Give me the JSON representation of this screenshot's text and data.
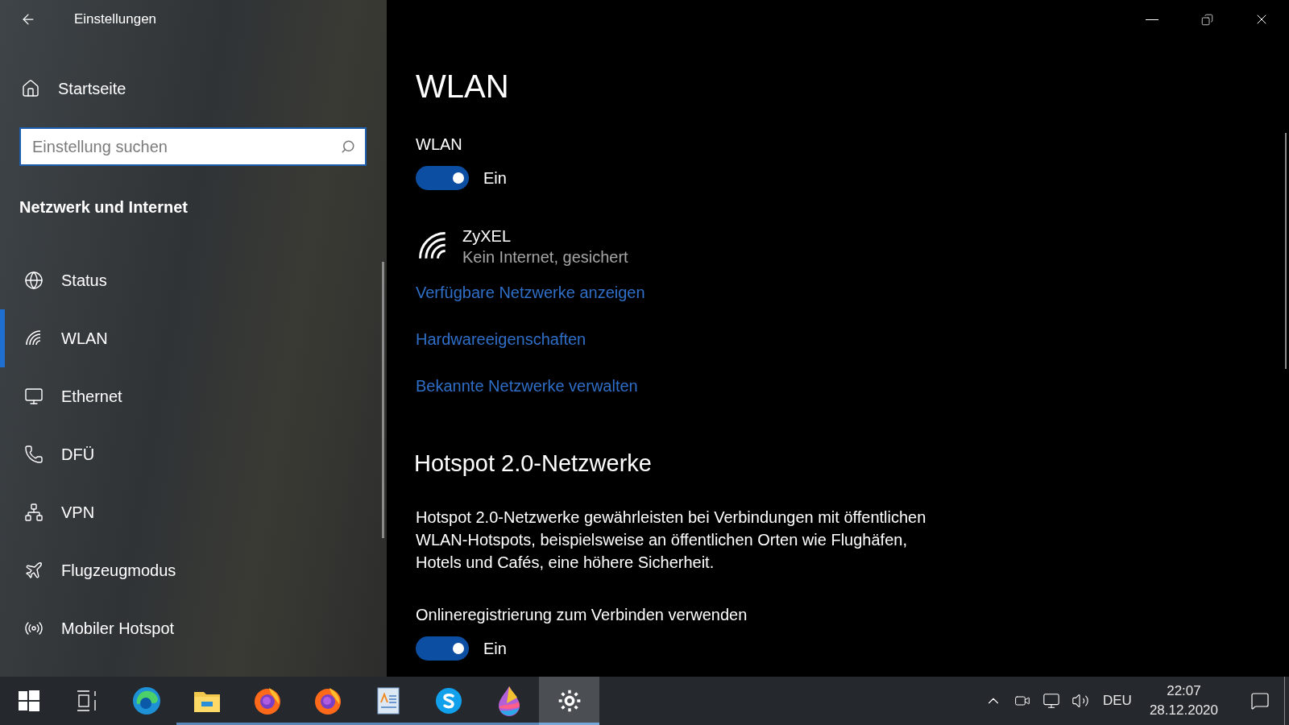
{
  "window": {
    "title": "Einstellungen"
  },
  "sidebar": {
    "home": "Startseite",
    "search": {
      "placeholder": "Einstellung suchen"
    },
    "section": "Netzwerk und Internet",
    "items": [
      {
        "label": "Status",
        "selected": false
      },
      {
        "label": "WLAN",
        "selected": true
      },
      {
        "label": "Ethernet",
        "selected": false
      },
      {
        "label": "DFÜ",
        "selected": false
      },
      {
        "label": "VPN",
        "selected": false
      },
      {
        "label": "Flugzeugmodus",
        "selected": false
      },
      {
        "label": "Mobiler Hotspot",
        "selected": false
      }
    ]
  },
  "content": {
    "title": "WLAN",
    "wlan_toggle": {
      "label": "WLAN",
      "on": true,
      "state_text": "Ein"
    },
    "network": {
      "name": "ZyXEL",
      "status": "Kein Internet, gesichert"
    },
    "links": [
      "Verfügbare Netzwerke anzeigen",
      "Hardwareeigenschaften",
      "Bekannte Netzwerke verwalten"
    ],
    "hotspot_heading": "Hotspot 2.0-Netzwerke",
    "hotspot_text": "Hotspot 2.0-Netzwerke gewährleisten bei Verbindungen mit öffentlichen WLAN-Hotspots, beispielsweise an öffentlichen Orten wie Flughäfen, Hotels und Cafés, eine höhere Sicherheit.",
    "online_toggle": {
      "label": "Onlineregistrierung zum Verbinden verwenden",
      "on": true,
      "state_text": "Ein"
    }
  },
  "taskbar": {
    "apps": [
      {
        "running": false,
        "selected": false
      },
      {
        "running": true,
        "selected": false
      },
      {
        "running": true,
        "selected": false
      },
      {
        "running": true,
        "selected": false
      },
      {
        "running": true,
        "selected": false
      },
      {
        "running": true,
        "selected": false
      },
      {
        "running": true,
        "selected": false
      },
      {
        "running": true,
        "selected": true
      }
    ],
    "language": "DEU",
    "time": "22:07",
    "date": "28.12.2020"
  }
}
